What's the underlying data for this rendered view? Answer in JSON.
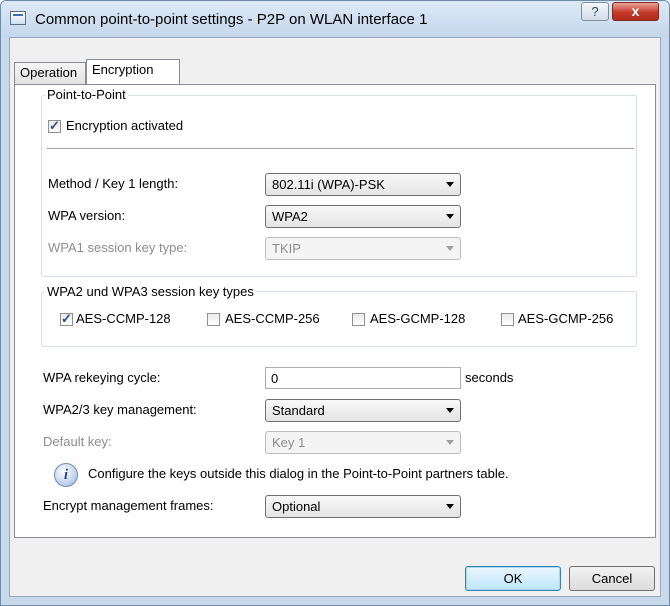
{
  "window": {
    "title": "Common point-to-point settings - P2P on WLAN interface 1",
    "help_glyph": "?",
    "close_glyph": "x"
  },
  "tabs": [
    {
      "label": "Operation",
      "active": false
    },
    {
      "label": "Encryption",
      "active": true
    }
  ],
  "p2p_group": {
    "legend": "Point-to-Point",
    "encryption_activated": {
      "label": "Encryption activated",
      "checked": true
    },
    "method": {
      "label": "Method / Key 1 length:",
      "value": "802.11i (WPA)-PSK"
    },
    "wpa_version": {
      "label": "WPA version:",
      "value": "WPA2"
    },
    "wpa1_key_type": {
      "label": "WPA1 session key type:",
      "value": "TKIP",
      "disabled": true
    }
  },
  "session_keys_group": {
    "legend": "WPA2 und WPA3 session key types",
    "options": [
      {
        "label": "AES-CCMP-128",
        "checked": true
      },
      {
        "label": "AES-CCMP-256",
        "checked": false
      },
      {
        "label": "AES-GCMP-128",
        "checked": false
      },
      {
        "label": "AES-GCMP-256",
        "checked": false
      }
    ]
  },
  "rekeying": {
    "label": "WPA rekeying cycle:",
    "value": "0",
    "unit": "seconds"
  },
  "key_management": {
    "label": "WPA2/3 key management:",
    "value": "Standard"
  },
  "default_key": {
    "label": "Default key:",
    "value": "Key 1",
    "disabled": true
  },
  "info_text": "Configure the keys outside this dialog in the Point-to-Point partners table.",
  "mgmt_frames": {
    "label": "Encrypt management frames:",
    "value": "Optional"
  },
  "buttons": {
    "ok": "OK",
    "cancel": "Cancel"
  },
  "colors": {
    "frame": "#c9d9ec",
    "close_button": "#c4392a",
    "default_button": "#bee6fd"
  }
}
